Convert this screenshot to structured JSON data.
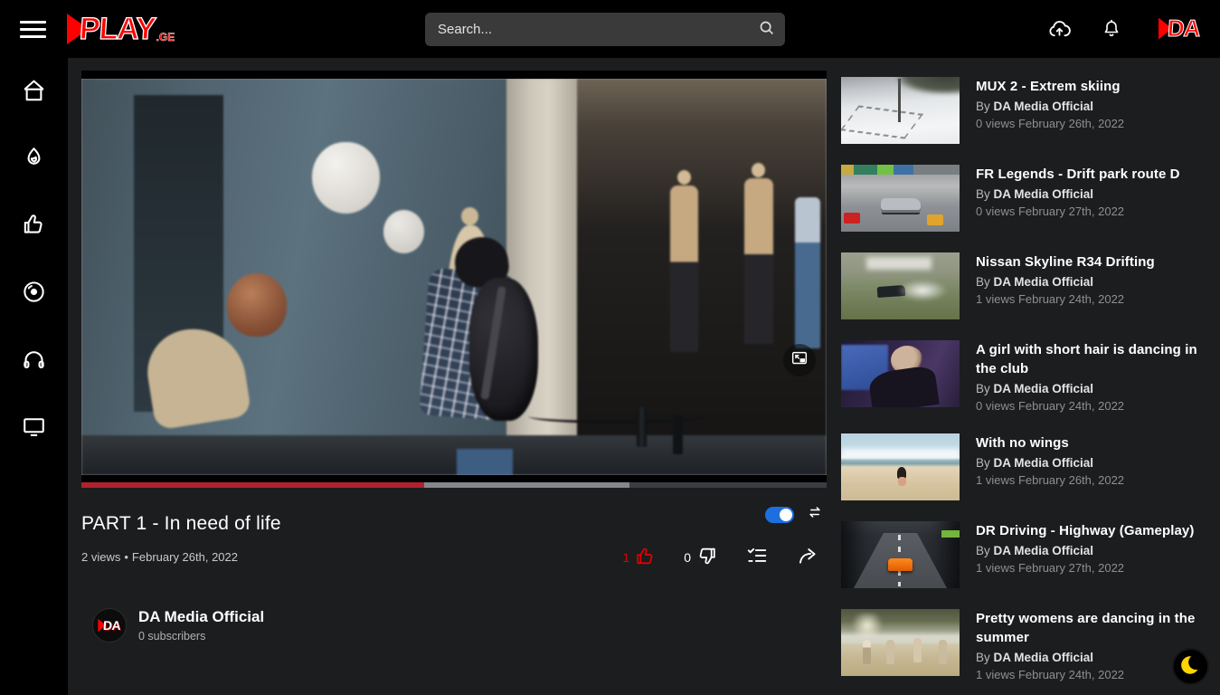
{
  "header": {
    "logo_text": "PLAY",
    "logo_suffix": ".GE",
    "search_placeholder": "Search...",
    "icons": [
      "menu-icon",
      "search-icon",
      "upload-cloud-icon",
      "notifications-bell-icon",
      "profile-da-logo"
    ]
  },
  "sidebar_icons": [
    "home-icon",
    "trending-flame-icon",
    "liked-thumb-icon",
    "disc-icon",
    "headphones-icon",
    "tv-icon"
  ],
  "player": {
    "title": "PART 1 - In need of life",
    "views": "2 views",
    "meta_separator": "•",
    "date": "February 26th, 2022",
    "like_count": "1",
    "dislike_count": "0",
    "autoplay_on": true,
    "progress": {
      "played_pct": 46,
      "buffered_pct": 73.5
    }
  },
  "channel": {
    "name": "DA Media Official",
    "subscribers": "0 subscribers",
    "avatar_text": "DA"
  },
  "labels": {
    "by": "By"
  },
  "recommended": [
    {
      "title": "MUX 2 - Extrem skiing",
      "channel": "DA Media Official",
      "meta": "0 views February 26th, 2022",
      "thumb": "ski"
    },
    {
      "title": "FR Legends - Drift park route D",
      "channel": "DA Media Official",
      "meta": "0 views February 27th, 2022",
      "thumb": "frlegends"
    },
    {
      "title": "Nissan Skyline R34 Drifting",
      "channel": "DA Media Official",
      "meta": "1 views February 24th, 2022",
      "thumb": "skyline"
    },
    {
      "title": "A girl with short hair is dancing in the club",
      "channel": "DA Media Official",
      "meta": "0 views February 24th, 2022",
      "thumb": "club"
    },
    {
      "title": "With no wings",
      "channel": "DA Media Official",
      "meta": "1 views February 26th, 2022",
      "thumb": "beach"
    },
    {
      "title": "DR Driving - Highway (Gameplay)",
      "channel": "DA Media Official",
      "meta": "1 views February 27th, 2022",
      "thumb": "drdriving"
    },
    {
      "title": "Pretty womens are dancing in the summer",
      "channel": "DA Media Official",
      "meta": "1 views February 24th, 2022",
      "thumb": "summer"
    }
  ],
  "colors": {
    "accent_red": "#fe0000",
    "progress_played": "#b1212d",
    "progress_buffered": "#84878c",
    "toggle_blue": "#1d6fe0",
    "moon_yellow": "#ffd400",
    "topbar_black": "#000000",
    "page_bg": "#1c1d1e"
  }
}
